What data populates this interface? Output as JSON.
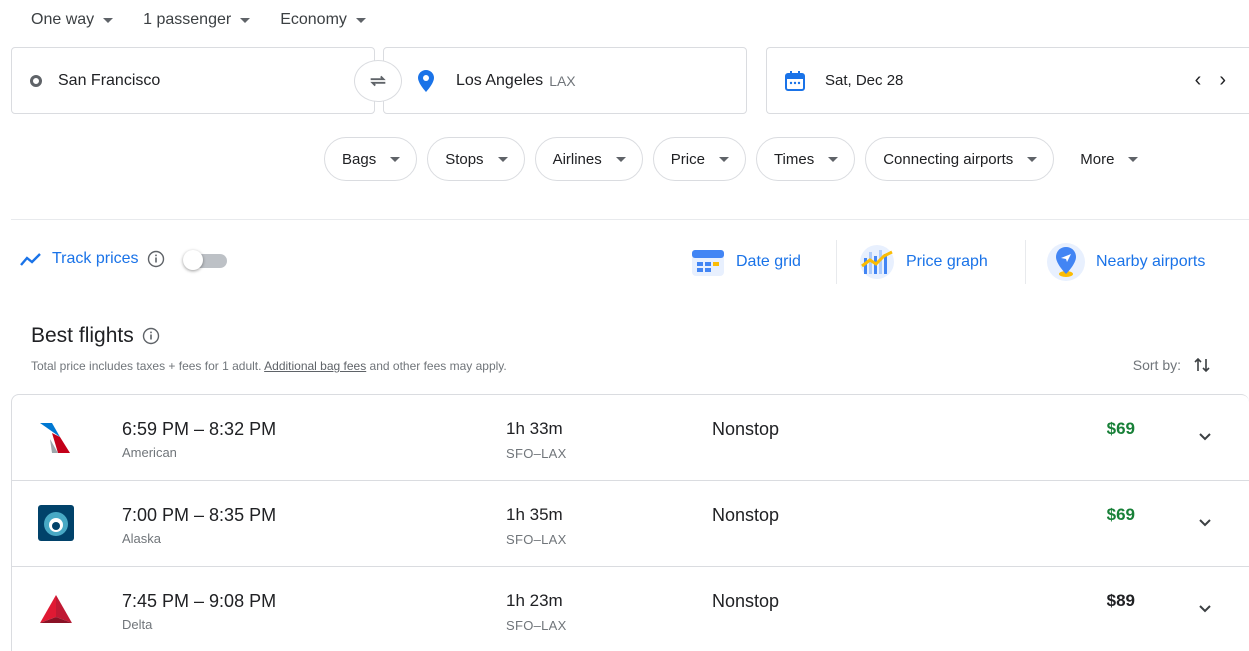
{
  "trip": {
    "type_label": "One way",
    "passengers_label": "1 passenger",
    "class_label": "Economy"
  },
  "search": {
    "from": "San Francisco",
    "to": "Los Angeles",
    "to_code": "LAX",
    "date": "Sat, Dec 28",
    "prev_date_glyph": "‹",
    "next_date_glyph": "›"
  },
  "filters": [
    "Bags",
    "Stops",
    "Airlines",
    "Price",
    "Times",
    "Connecting airports"
  ],
  "more_label": "More",
  "tools": {
    "track_prices": "Track prices",
    "track_enabled": false,
    "date_grid": "Date grid",
    "price_graph": "Price graph",
    "nearby_airports": "Nearby airports"
  },
  "results": {
    "title": "Best flights",
    "disclaimer_pre": "Total price includes taxes + fees for 1 adult. ",
    "disclaimer_link": "Additional bag fees",
    "disclaimer_post": " and other fees may apply.",
    "sort_label": "Sort by:",
    "flights": [
      {
        "times": "6:59 PM – 8:32 PM",
        "airline": "American",
        "duration": "1h 33m",
        "route": "SFO–LAX",
        "stops": "Nonstop",
        "price": "$69",
        "low_price": true,
        "logo": "american-logo"
      },
      {
        "times": "7:00 PM – 8:35 PM",
        "airline": "Alaska",
        "duration": "1h 35m",
        "route": "SFO–LAX",
        "stops": "Nonstop",
        "price": "$69",
        "low_price": true,
        "logo": "alaska-logo"
      },
      {
        "times": "7:45 PM – 9:08 PM",
        "airline": "Delta",
        "duration": "1h 23m",
        "route": "SFO–LAX",
        "stops": "Nonstop",
        "price": "$89",
        "low_price": false,
        "logo": "delta-logo"
      }
    ]
  },
  "colors": {
    "accent": "#1a73e8",
    "low_price": "#188038",
    "border": "#dadce0",
    "muted_text": "#70757a"
  }
}
